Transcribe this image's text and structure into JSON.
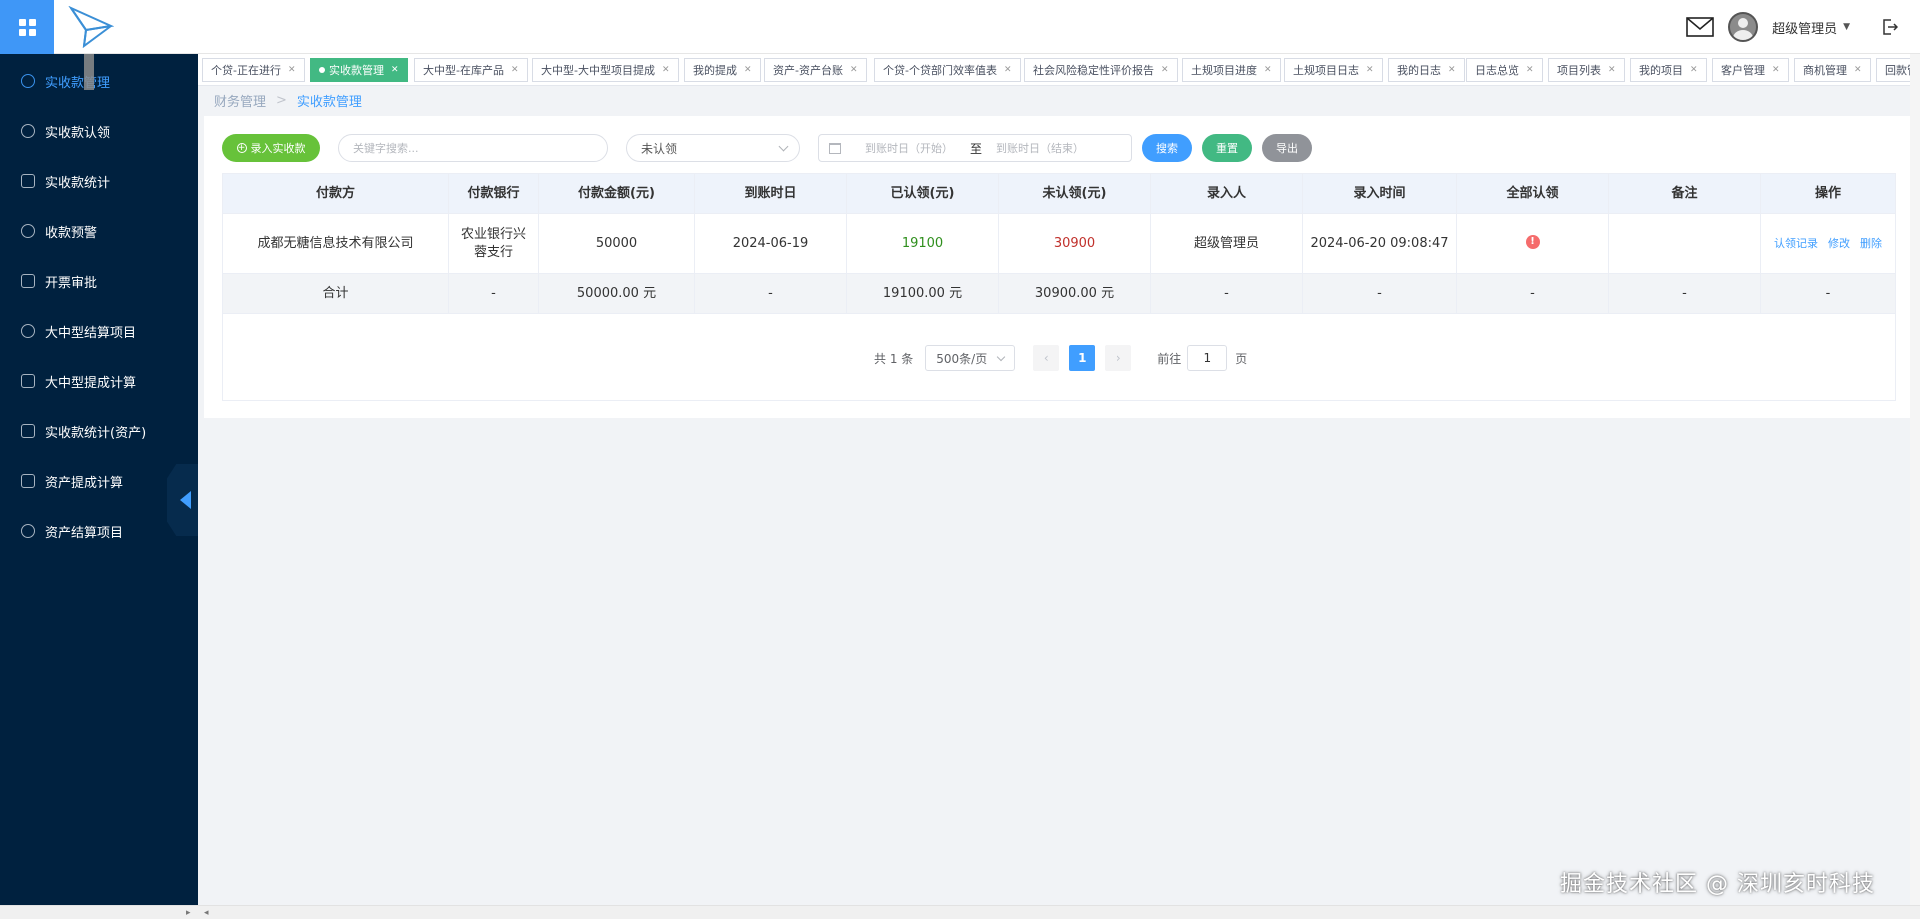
{
  "header": {
    "user_name": "超级管理员"
  },
  "sidebar": {
    "items": [
      {
        "label": "实收款管理",
        "active": true
      },
      {
        "label": "实收款认领"
      },
      {
        "label": "实收款统计"
      },
      {
        "label": "收款预警"
      },
      {
        "label": "开票审批"
      },
      {
        "label": "大中型结算项目"
      },
      {
        "label": "大中型提成计算"
      },
      {
        "label": "实收款统计(资产)"
      },
      {
        "label": "资产提成计算"
      },
      {
        "label": "资产结算项目"
      }
    ]
  },
  "tabs": [
    {
      "label": "个贷-正在进行"
    },
    {
      "label": "实收款管理",
      "active": true
    },
    {
      "label": "大中型-在库产品"
    },
    {
      "label": "大中型-大中型项目提成"
    },
    {
      "label": "我的提成"
    },
    {
      "label": "资产-资产台账"
    },
    {
      "label": "个贷-个贷部门效率值表"
    },
    {
      "label": "社会风险稳定性评价报告"
    },
    {
      "label": "土规项目进度"
    },
    {
      "label": "土规项目日志"
    },
    {
      "label": "我的日志"
    },
    {
      "label": "日志总览"
    },
    {
      "label": "项目列表"
    },
    {
      "label": "我的项目"
    },
    {
      "label": "客户管理"
    },
    {
      "label": "商机管理"
    },
    {
      "label": "回款管"
    }
  ],
  "breadcrumb": {
    "parent": "财务管理",
    "separator": ">",
    "current": "实收款管理"
  },
  "toolbar": {
    "add_label": "录入实收款",
    "search_placeholder": "关键字搜索...",
    "status_selected": "未认领",
    "date_start_placeholder": "到账时日（开始）",
    "date_to": "至",
    "date_end_placeholder": "到账时日（结束）",
    "search_label": "搜索",
    "reset_label": "重置",
    "export_label": "导出"
  },
  "table": {
    "columns": [
      "付款方",
      "付款银行",
      "付款金额(元)",
      "到账时日",
      "已认领(元)",
      "未认领(元)",
      "录入人",
      "录入时间",
      "全部认领",
      "备注",
      "操作"
    ],
    "rows": [
      {
        "payer": "成都无糖信息技术有限公司",
        "bank": "农业银行兴蓉支行",
        "amount": "50000",
        "date": "2024-06-19",
        "claimed": "19100",
        "unclaimed": "30900",
        "entered_by": "超级管理员",
        "entered_at": "2024-06-20 09:08:47",
        "all_claimed_icon": "!",
        "remark": "",
        "actions": [
          "认领记录",
          "修改",
          "删除"
        ]
      }
    ],
    "summary": {
      "label": "合计",
      "bank": "-",
      "amount": "50000.00 元",
      "date": "-",
      "claimed": "19100.00 元",
      "unclaimed": "30900.00 元",
      "entered_by": "-",
      "entered_at": "-",
      "all_claimed": "-",
      "remark": "-",
      "actions": "-"
    }
  },
  "pagination": {
    "total_text": "共 1 条",
    "page_size": "500条/页",
    "prev": "‹",
    "current_page": "1",
    "next": "›",
    "goto_label": "前往",
    "goto_value": "1",
    "goto_suffix": "页"
  },
  "watermark": "掘金技术社区 @ 深圳亥时科技",
  "colors": {
    "sidebar_bg": "#00213f",
    "primary": "#409eff",
    "success": "#67c23a",
    "tab_active": "#42b983",
    "claimed": "#2f8f1d",
    "unclaimed": "#c0302b"
  }
}
